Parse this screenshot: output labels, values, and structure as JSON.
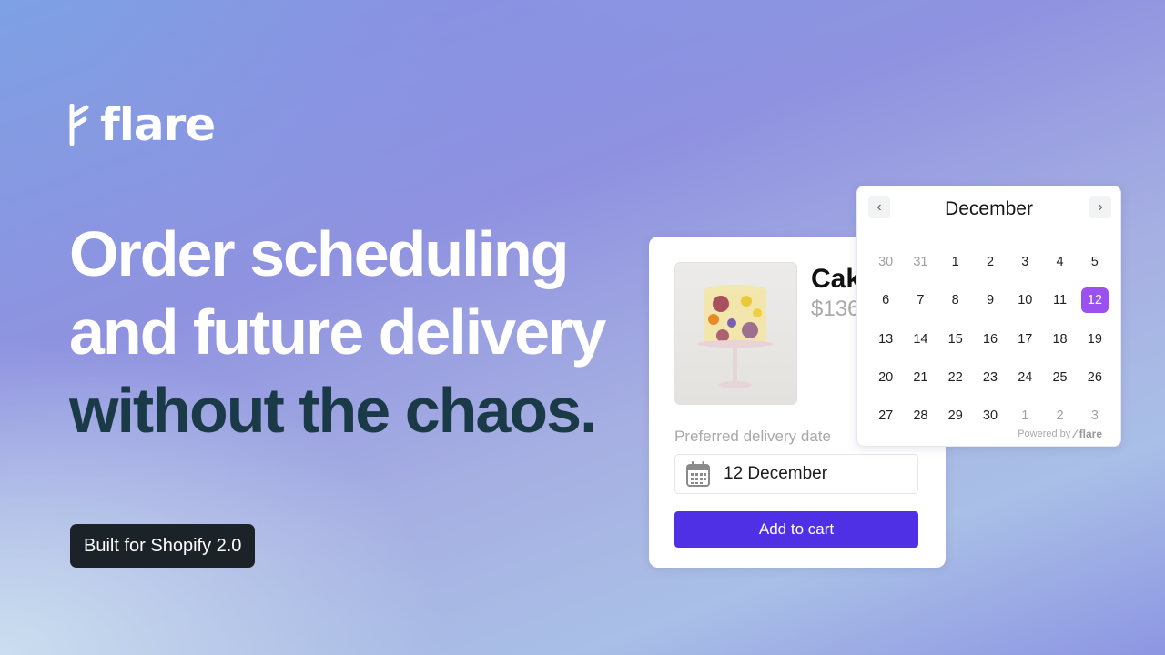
{
  "brand": {
    "name": "flare",
    "logo_icon": "flare-logo-icon"
  },
  "headline": {
    "line1": "Order scheduling",
    "line2": "and future delivery",
    "line3": "without the chaos."
  },
  "badge": {
    "label": "Built for Shopify 2.0"
  },
  "colors": {
    "headline_accent": "#1b3a48",
    "button": "#5030e5",
    "selected_day": "#9b51f0",
    "badge_bg": "#1b2228"
  },
  "product_card": {
    "product_name": "Cak",
    "price": "$136",
    "image_alt": "cake with pressed flowers on a glass stand",
    "delivery_label": "Preferred delivery date",
    "date_icon": "calendar-icon",
    "date_value": "12 December",
    "add_to_cart_label": "Add to cart"
  },
  "calendar": {
    "month": "December",
    "prev_icon": "chevron-left-icon",
    "next_icon": "chevron-right-icon",
    "selected": "12",
    "weeks": [
      [
        {
          "d": "30",
          "m": true
        },
        {
          "d": "31",
          "m": true
        },
        {
          "d": "1"
        },
        {
          "d": "2"
        },
        {
          "d": "3"
        },
        {
          "d": "4"
        },
        {
          "d": "5"
        }
      ],
      [
        {
          "d": "6"
        },
        {
          "d": "7"
        },
        {
          "d": "8"
        },
        {
          "d": "9"
        },
        {
          "d": "10"
        },
        {
          "d": "11"
        },
        {
          "d": "12",
          "s": true
        }
      ],
      [
        {
          "d": "13"
        },
        {
          "d": "14"
        },
        {
          "d": "15"
        },
        {
          "d": "16"
        },
        {
          "d": "17"
        },
        {
          "d": "18"
        },
        {
          "d": "19"
        }
      ],
      [
        {
          "d": "20"
        },
        {
          "d": "21"
        },
        {
          "d": "22"
        },
        {
          "d": "23"
        },
        {
          "d": "24"
        },
        {
          "d": "25"
        },
        {
          "d": "26"
        }
      ],
      [
        {
          "d": "27"
        },
        {
          "d": "28"
        },
        {
          "d": "29"
        },
        {
          "d": "30"
        },
        {
          "d": "1",
          "m": true
        },
        {
          "d": "2",
          "m": true
        },
        {
          "d": "3",
          "m": true
        }
      ]
    ],
    "powered_by": "Powered by",
    "powered_brand": "flare"
  }
}
